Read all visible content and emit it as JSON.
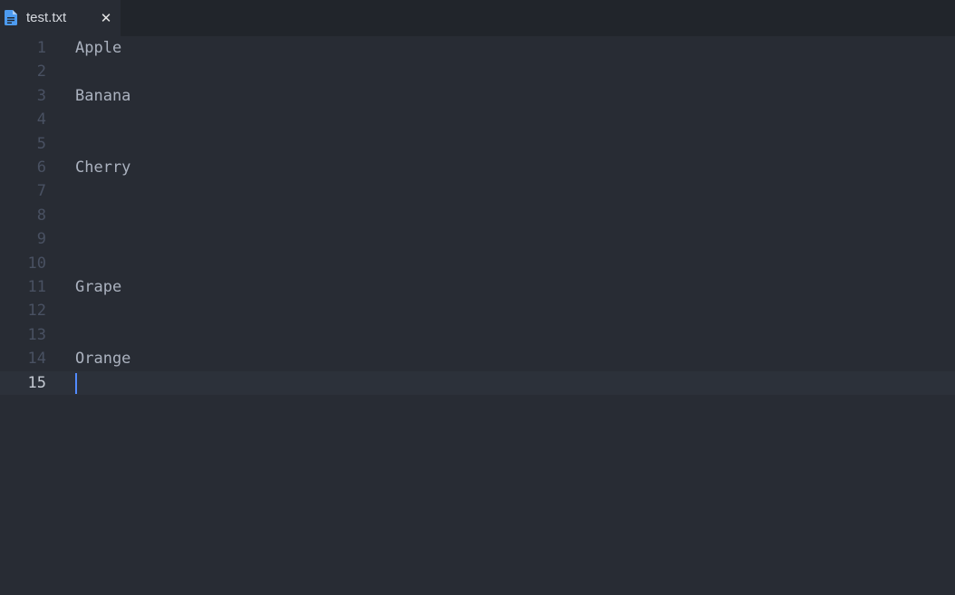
{
  "tab": {
    "title": "test.txt",
    "close_glyph": "✕",
    "icon": "file-text-icon",
    "icon_color": "#4d9bf0"
  },
  "editor": {
    "active_line": 15,
    "lines": [
      {
        "num": "1",
        "text": "Apple"
      },
      {
        "num": "2",
        "text": ""
      },
      {
        "num": "3",
        "text": "Banana"
      },
      {
        "num": "4",
        "text": ""
      },
      {
        "num": "5",
        "text": ""
      },
      {
        "num": "6",
        "text": "Cherry"
      },
      {
        "num": "7",
        "text": ""
      },
      {
        "num": "8",
        "text": ""
      },
      {
        "num": "9",
        "text": ""
      },
      {
        "num": "10",
        "text": ""
      },
      {
        "num": "11",
        "text": "Grape"
      },
      {
        "num": "12",
        "text": ""
      },
      {
        "num": "13",
        "text": ""
      },
      {
        "num": "14",
        "text": "Orange"
      },
      {
        "num": "15",
        "text": ""
      }
    ]
  },
  "colors": {
    "background": "#282c34",
    "tabbar": "#21252b",
    "active_line": "#2c313a",
    "cursor": "#528bff",
    "text": "#abb2bf",
    "gutter": "#495162"
  }
}
